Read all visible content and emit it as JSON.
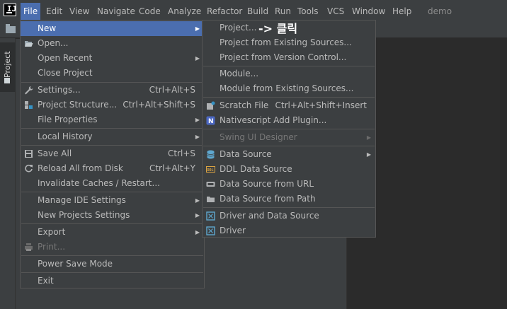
{
  "menubar": {
    "items": [
      {
        "label": "File",
        "active": true
      },
      {
        "label": "Edit"
      },
      {
        "label": "View"
      },
      {
        "label": "Navigate"
      },
      {
        "label": "Code"
      },
      {
        "label": "Analyze"
      },
      {
        "label": "Refactor"
      },
      {
        "label": "Build"
      },
      {
        "label": "Run"
      },
      {
        "label": "Tools"
      },
      {
        "label": "VCS"
      },
      {
        "label": "Window"
      },
      {
        "label": "Help"
      }
    ],
    "project_name": "demo"
  },
  "sidebar": {
    "project_tab_label": "Project"
  },
  "file_menu": {
    "items": [
      {
        "label": "New",
        "submenu": true,
        "selected": true
      },
      {
        "label": "Open...",
        "icon": "folder-open-icon"
      },
      {
        "label": "Open Recent",
        "submenu": true
      },
      {
        "label": "Close Project"
      },
      {
        "label": "Settings...",
        "shortcut": "Ctrl+Alt+S",
        "icon": "wrench-icon"
      },
      {
        "label": "Project Structure...",
        "shortcut": "Ctrl+Alt+Shift+S",
        "icon": "project-structure-icon"
      },
      {
        "label": "File Properties",
        "submenu": true
      },
      {
        "label": "Local History",
        "submenu": true
      },
      {
        "label": "Save All",
        "shortcut": "Ctrl+S",
        "icon": "save-icon"
      },
      {
        "label": "Reload All from Disk",
        "shortcut": "Ctrl+Alt+Y",
        "icon": "reload-icon"
      },
      {
        "label": "Invalidate Caches / Restart..."
      },
      {
        "label": "Manage IDE Settings",
        "submenu": true
      },
      {
        "label": "New Projects Settings",
        "submenu": true
      },
      {
        "label": "Export",
        "submenu": true
      },
      {
        "label": "Print...",
        "disabled": true,
        "icon": "print-icon"
      },
      {
        "label": "Power Save Mode"
      },
      {
        "label": "Exit"
      }
    ]
  },
  "new_submenu": {
    "items": [
      {
        "label": "Project..."
      },
      {
        "label": "Project from Existing Sources..."
      },
      {
        "label": "Project from Version Control..."
      },
      {
        "label": "Module..."
      },
      {
        "label": "Module from Existing Sources..."
      },
      {
        "label": "Scratch File",
        "shortcut": "Ctrl+Alt+Shift+Insert",
        "icon": "scratch-file-icon"
      },
      {
        "label": "Nativescript Add Plugin...",
        "icon": "nativescript-icon"
      },
      {
        "label": "Swing UI Designer",
        "submenu": true,
        "disabled": true
      },
      {
        "label": "Data Source",
        "submenu": true,
        "icon": "database-icon"
      },
      {
        "label": "DDL Data Source",
        "icon": "ddl-icon"
      },
      {
        "label": "Data Source from URL",
        "icon": "url-icon"
      },
      {
        "label": "Data Source from Path",
        "icon": "folder-icon"
      },
      {
        "label": "Driver and Data Source",
        "icon": "driver-icon"
      },
      {
        "label": "Driver",
        "icon": "driver-icon"
      }
    ]
  },
  "annotation": {
    "text": "-> 클릭"
  },
  "colors": {
    "selection": "#4b6eaf",
    "menu_bg": "#3c3f41",
    "editor_bg": "#2b2b2b",
    "text": "#bbbbbb"
  }
}
